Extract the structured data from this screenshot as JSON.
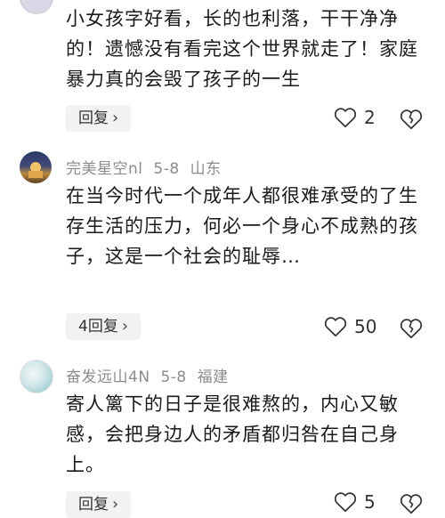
{
  "comments": [
    {
      "text": "小女孩字好看，长的也利落，干干净净的！遗憾没有看完这个世界就走了！家庭暴力真的会毁了孩子的一生",
      "reply_label": "回复",
      "likes": "2"
    },
    {
      "username": "完美星空nl",
      "date": "5-8",
      "location": "山东",
      "text": "在当今时代一个成年人都很难承受的了生存生活的压力，何必一个身心不成熟的孩子，这是一个社会的耻辱…",
      "reply_label": "4回复",
      "likes": "50"
    },
    {
      "username": "奋发远山4N",
      "date": "5-8",
      "location": "福建",
      "text": "寄人篱下的日子是很难熬的，内心又敏感，会把身边人的矛盾都归咎在自己身上。",
      "reply_label": "回复",
      "likes": "5"
    }
  ],
  "icons": {
    "like": "heart-outline-icon",
    "dislike": "heart-broken-outline-icon",
    "chevron": "chevron-right-icon"
  },
  "colors": {
    "meta": "#8c8c8c",
    "pill_bg": "#f2f2f2",
    "text": "#1a1a1a"
  }
}
